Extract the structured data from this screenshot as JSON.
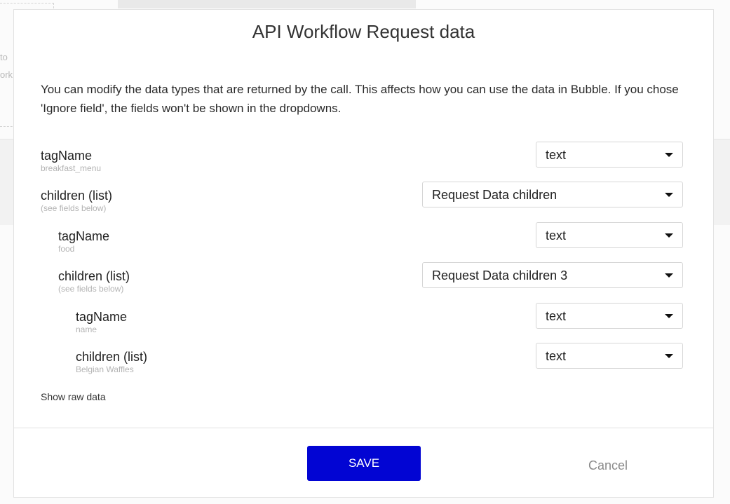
{
  "background": {
    "fragments": [
      "to",
      "ork"
    ]
  },
  "modal": {
    "title": "API Workflow Request data",
    "description": "You can modify the data types that are returned by the call. This affects how you can use the data in Bubble. If you chose 'Ignore field', the fields won't be shown in the dropdowns.",
    "fields": [
      {
        "name": "tagName",
        "sub": "breakfast_menu",
        "type": "text",
        "depth": 0
      },
      {
        "name": "children (list)",
        "sub": "(see fields below)",
        "type": "Request Data children",
        "depth": 0
      },
      {
        "name": "tagName",
        "sub": "food",
        "type": "text",
        "depth": 1
      },
      {
        "name": "children (list)",
        "sub": "(see fields below)",
        "type": "Request Data children 3",
        "depth": 1
      },
      {
        "name": "tagName",
        "sub": "name",
        "type": "text",
        "depth": 2
      },
      {
        "name": "children (list)",
        "sub": "Belgian Waffles",
        "type": "text",
        "depth": 2
      }
    ],
    "show_raw_label": "Show raw data",
    "save_label": "SAVE",
    "cancel_label": "Cancel"
  },
  "colors": {
    "save_button": "#0205d3",
    "cancel_text": "#8a8a8a"
  },
  "icons": {
    "dropdown": "caret-down-icon"
  }
}
